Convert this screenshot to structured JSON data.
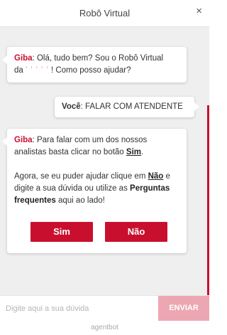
{
  "header": {
    "title": "Robô Virtual",
    "close_glyph": "×"
  },
  "messages": {
    "greeting": {
      "name": "Giba",
      "line1": ": Olá, tudo bem? Sou o Robô Virtual",
      "line2_start": "da ",
      "redacted": "' ' ' ' '",
      "line2_end": " ! Como posso ajudar?"
    },
    "user": {
      "name": "Você",
      "text": ": FALAR COM ATENDENTE"
    },
    "reply": {
      "name": "Giba",
      "p1_text": ": Para falar com um dos nossos analistas basta clicar no botão ",
      "p1_link": "Sim",
      "p1_end": ".",
      "p2_a": "Agora, se eu puder ajudar clique em ",
      "p2_link": "Não",
      "p2_b": " e digite a sua dúvida ou utilize as ",
      "p2_bold": "Perguntas frequentes",
      "p2_c": " aqui ao lado!"
    }
  },
  "buttons": {
    "yes": "Sim",
    "no": "Não"
  },
  "input": {
    "placeholder": "Digite aqui a sua dúvida",
    "value": ""
  },
  "send_label": "ENVIAR",
  "footer": {
    "brand": "agentbot"
  },
  "colors": {
    "accent": "#c8102e",
    "send_disabled": "#eda7b2",
    "chat_bg": "#efefef"
  },
  "icons": {
    "close": "close-icon"
  }
}
